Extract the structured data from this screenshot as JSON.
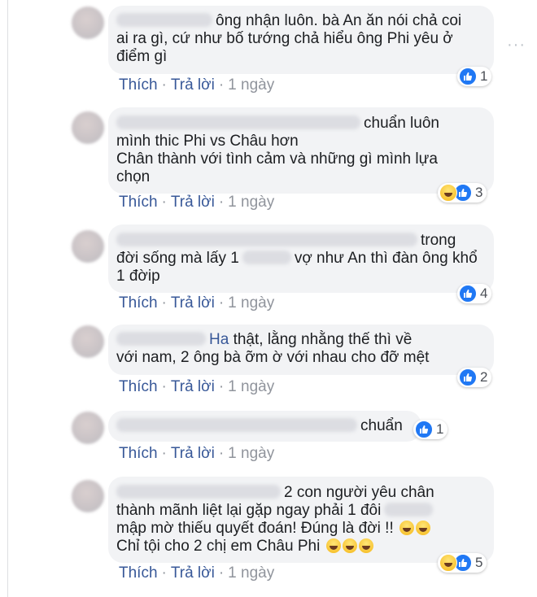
{
  "more_menu": "···",
  "comments": [
    {
      "lines": [
        "ông nhận luôn. bà An ăn nói chả coi",
        "ai ra gì, cứ như bố tướng chả hiểu ông Phi yêu ở",
        "điểm gì"
      ],
      "actions": {
        "like": "Thích",
        "sep": "·",
        "reply": "Trả lời",
        "time": "1 ngày"
      },
      "reactions": {
        "types": [
          "like"
        ],
        "count": "1"
      }
    },
    {
      "lines": [
        "chuẩn luôn",
        "mình thic Phi vs Châu hơn",
        "Chân thành với tình cảm và những gì mình lựa",
        "chọn"
      ],
      "actions": {
        "like": "Thích",
        "sep": "·",
        "reply": "Trả lời",
        "time": "1 ngày"
      },
      "reactions": {
        "types": [
          "haha",
          "like"
        ],
        "count": "3"
      }
    },
    {
      "lines": [
        "trong",
        "đời sống mà lấy 1",
        "vợ như An thì đàn ông khổ",
        "1 đờip"
      ],
      "actions": {
        "like": "Thích",
        "sep": "·",
        "reply": "Trả lời",
        "time": "1 ngày"
      },
      "reactions": {
        "types": [
          "like"
        ],
        "count": "4"
      }
    },
    {
      "name": "Ha",
      "lines": [
        "thật, lằng nhằng thế thì về",
        "với nam, 2 ông bà ỡm ờ với nhau cho đỡ mệt"
      ],
      "actions": {
        "like": "Thích",
        "sep": "·",
        "reply": "Trả lời",
        "time": "1 ngày"
      },
      "reactions": {
        "types": [
          "like"
        ],
        "count": "2"
      }
    },
    {
      "lines": [
        "chuẩn"
      ],
      "actions": {
        "like": "Thích",
        "sep": "·",
        "reply": "Trả lời",
        "time": "1 ngày"
      },
      "reactions": {
        "types": [
          "like"
        ],
        "count": "1"
      }
    },
    {
      "lines": [
        "2 con người yêu chân",
        "thành mãnh liệt lại gặp ngay phải 1 đôi",
        "mập mờ thiếu quyết đoán! Đúng là đời !!",
        "Chỉ tội cho 2 chị em Châu Phi"
      ],
      "actions": {
        "like": "Thích",
        "sep": "·",
        "reply": "Trả lời",
        "time": "1 ngày"
      },
      "reactions": {
        "types": [
          "haha",
          "like"
        ],
        "count": "5"
      }
    }
  ]
}
